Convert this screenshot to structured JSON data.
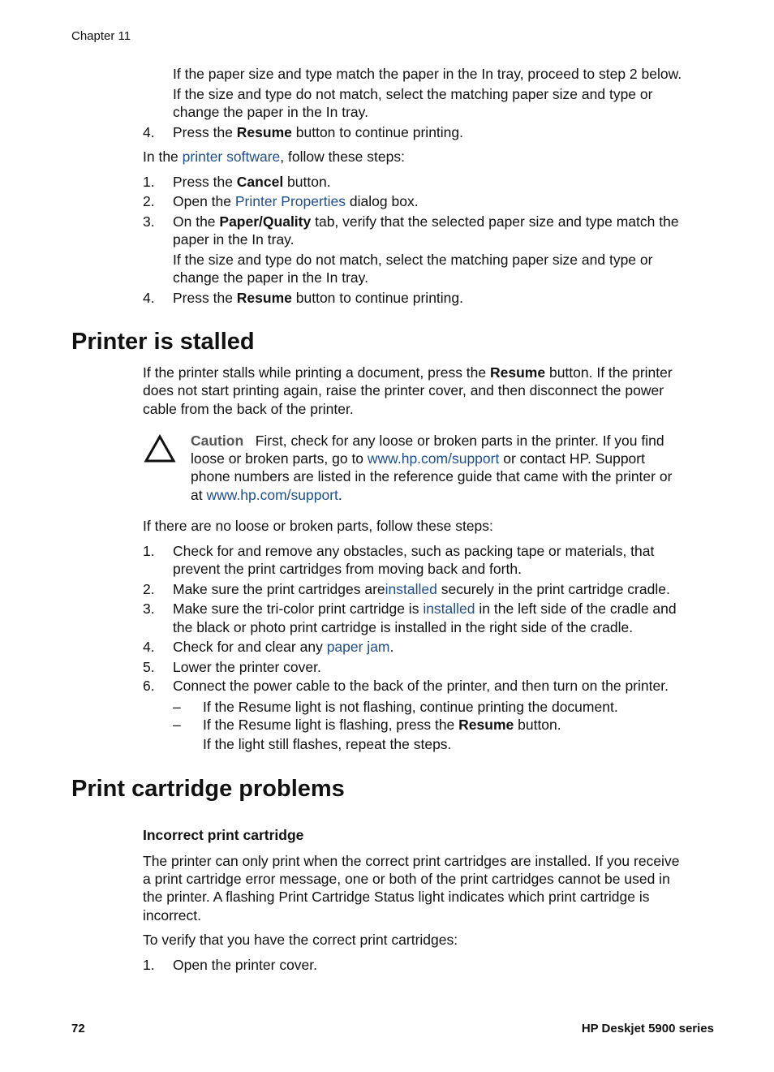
{
  "header": {
    "chapter": "Chapter 11"
  },
  "top_section": {
    "sub_para_1": "If the paper size and type match the paper in the In tray, proceed to step 2 below.",
    "sub_para_2_line1": "If the size and type do not match, select the matching paper size and type or",
    "sub_para_2_line2": "change the paper in the In tray.",
    "step4": {
      "num": "4.",
      "pre": "Press the ",
      "bold": "Resume",
      "post": " button to continue printing."
    },
    "software_intro": {
      "pre": "In the ",
      "link": "printer software",
      "post": ", follow these steps:"
    },
    "steps": [
      {
        "num": "1.",
        "pre": "Press the ",
        "bold": "Cancel",
        "post": " button."
      },
      {
        "num": "2.",
        "pre": "Open the ",
        "link": "Printer Properties",
        "post": " dialog box."
      },
      {
        "num": "3.",
        "pre": "On the ",
        "bold": "Paper/Quality",
        "post": " tab, verify that the selected paper size and type match the",
        "line2": "paper in the In tray.",
        "sub1": "If the size and type do not match, select the matching paper size and type or",
        "sub2": "change the paper in the In tray."
      },
      {
        "num": "4.",
        "pre": "Press the ",
        "bold": "Resume",
        "post": " button to continue printing."
      }
    ]
  },
  "stalled": {
    "heading": "Printer is stalled",
    "intro_l1_pre": "If the printer stalls while printing a document, press the ",
    "intro_l1_bold": "Resume",
    "intro_l1_post": " button. If the printer",
    "intro_l2": "does not start printing again, raise the printer cover, and then disconnect the power",
    "intro_l3": "cable from the back of the printer.",
    "caution": {
      "label": "Caution",
      "l1": "First, check for any loose or broken parts in the printer. If you find",
      "l2_pre": "loose or broken parts, go to ",
      "l2_link": "www.hp.com/support",
      "l2_post": " or contact HP. Support",
      "l3": "phone numbers are listed in the reference guide that came with the printer or",
      "l4_pre": "at ",
      "l4_link": "www.hp.com/support",
      "l4_post": "."
    },
    "steps_intro": "If there are no loose or broken parts, follow these steps:",
    "steps": [
      {
        "num": "1.",
        "l1": "Check for and remove any obstacles, such as packing tape or materials, that",
        "l2": "prevent the print cartridges from moving back and forth."
      },
      {
        "num": "2.",
        "pre": "Make sure the print cartridges are",
        "link": "installed",
        "post": " securely in the print cartridge cradle."
      },
      {
        "num": "3.",
        "pre": "Make sure the tri-color print cartridge is ",
        "link": "installed",
        "post": " in the left side of the cradle and",
        "l2": "the black or photo print cartridge is installed in the right side of the cradle."
      },
      {
        "num": "4.",
        "pre": "Check for and clear any ",
        "link": "paper jam",
        "post": "."
      },
      {
        "num": "5.",
        "l1": "Lower the printer cover."
      },
      {
        "num": "6.",
        "l1": "Connect the power cable to the back of the printer, and then turn on the printer."
      }
    ],
    "bullets": [
      {
        "dash": "–",
        "text": "If the Resume light is not flashing, continue printing the document."
      },
      {
        "dash": "–",
        "pre": "If the Resume light is flashing, press the ",
        "bold": "Resume",
        "post": " button.",
        "sub": "If the light still flashes, repeat the steps."
      }
    ]
  },
  "cartridge": {
    "heading": "Print cartridge problems",
    "subheading": "Incorrect print cartridge",
    "para_l1": "The printer can only print when the correct print cartridges are installed. If you receive",
    "para_l2": "a print cartridge error message, one or both of the print cartridges cannot be used in",
    "para_l3": "the printer. A flashing Print Cartridge Status light indicates which print cartridge is",
    "para_l4": "incorrect.",
    "verify_intro": "To verify that you have the correct print cartridges:",
    "steps": [
      {
        "num": "1.",
        "text": "Open the printer cover."
      }
    ]
  },
  "footer": {
    "page_number": "72",
    "product": "HP Deskjet 5900 series"
  },
  "colors": {
    "link": "#1f4e8c",
    "caution_label": "#555555",
    "text": "#111111"
  }
}
